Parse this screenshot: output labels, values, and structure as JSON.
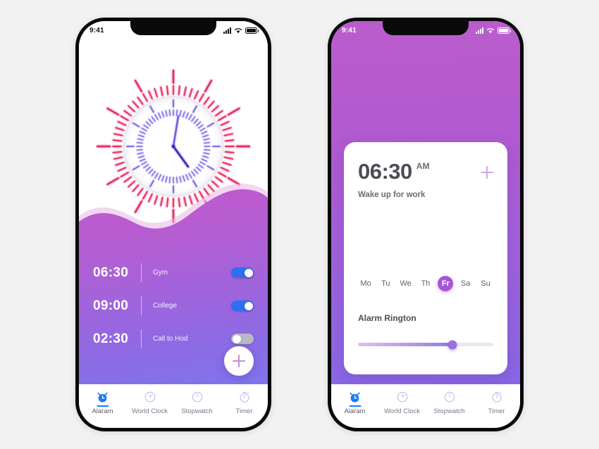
{
  "canvas": {
    "background": "#f2f2f2"
  },
  "status_bar": {
    "time": "9:41",
    "signal_icon": "signal-bars-icon",
    "wifi_icon": "wifi-icon",
    "battery_icon": "battery-icon"
  },
  "phone_left": {
    "clock": {
      "icon": "analog-clock-sunburst",
      "hour_hand_angle": 138,
      "minute_hand_angle": 12,
      "outer_tick_color": "#e8255f",
      "inner_tick_color": "#6a52e0"
    },
    "gradient": {
      "from": "#c05ccb",
      "mid": "#a265dd",
      "to": "#7a78ef"
    },
    "alarms": [
      {
        "time": "06:30",
        "label": "Gym",
        "enabled": true
      },
      {
        "time": "09:00",
        "label": "College",
        "enabled": true
      },
      {
        "time": "02:30",
        "label": "Call to Hod",
        "enabled": false
      }
    ],
    "fab": {
      "icon": "plus-icon",
      "label": "Add alarm"
    }
  },
  "phone_right": {
    "gradient": {
      "from": "#bb5ccc",
      "to": "#8069e8"
    },
    "card": {
      "time": "06:30",
      "meridiem": "AM",
      "subtitle": "Wake up for work",
      "add_icon": "plus-icon",
      "days": [
        {
          "label": "Mo",
          "selected": false
        },
        {
          "label": "Tu",
          "selected": false
        },
        {
          "label": "We",
          "selected": false
        },
        {
          "label": "Th",
          "selected": false
        },
        {
          "label": "Fr",
          "selected": true
        },
        {
          "label": "Sa",
          "selected": false
        },
        {
          "label": "Su",
          "selected": false
        }
      ],
      "ringtone_label": "Alarm Rington",
      "volume_percent": 70,
      "accent_color": "#a855d6"
    }
  },
  "nav": {
    "items": [
      {
        "label": "Alaram",
        "icon": "alarm-clock-icon",
        "active": true
      },
      {
        "label": "World Clock",
        "icon": "world-clock-icon",
        "active": false
      },
      {
        "label": "Stopwatch",
        "icon": "stopwatch-icon",
        "active": false
      },
      {
        "label": "Timer",
        "icon": "timer-icon",
        "active": false
      }
    ],
    "active_color": "#1a7cf5",
    "inactive_color": "#cbb3ee"
  }
}
